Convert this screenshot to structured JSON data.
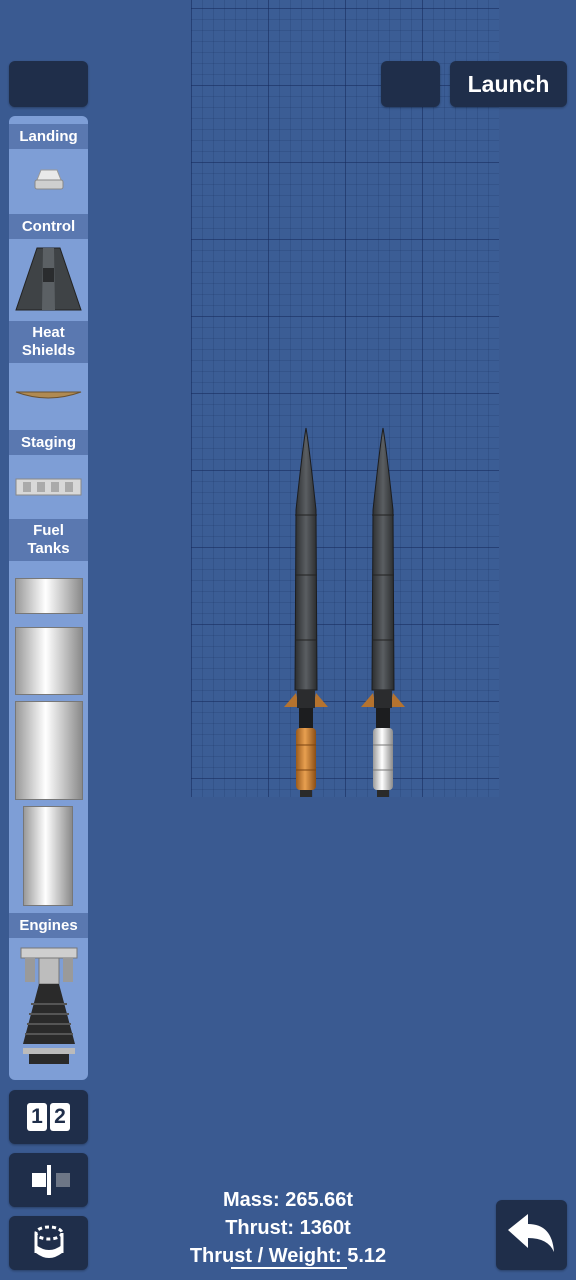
{
  "toolbar": {
    "launch_label": "Launch",
    "menu_icon": "menu-icon",
    "build_menu_icon": "hamburger-icon",
    "undo_icon": "undo-icon"
  },
  "palette": {
    "categories": [
      "Landing",
      "Control",
      "Heat Shields",
      "Staging",
      "Fuel Tanks",
      "Engines"
    ],
    "heat_shields_line1": "Heat",
    "heat_shields_line2": "Shields",
    "fuel_tanks_line1": "Fuel",
    "fuel_tanks_line2": "Tanks"
  },
  "left_tools": {
    "stage_digit_1": "1",
    "stage_digit_2": "2",
    "symmetry_icon": "symmetry-icon",
    "rotate_icon": "rotate-part-icon"
  },
  "stats": {
    "mass": "Mass: 265.66t",
    "thrust": "Thrust: 1360t",
    "twr": "Thrust / Weight: 5.12"
  },
  "colors": {
    "background": "#3a5a91",
    "button": "#1f2e4a",
    "palette": "#7e9ed6",
    "category_header": "#5a78b0",
    "fin": "#b5732f",
    "orange_tank": "#c88537"
  }
}
